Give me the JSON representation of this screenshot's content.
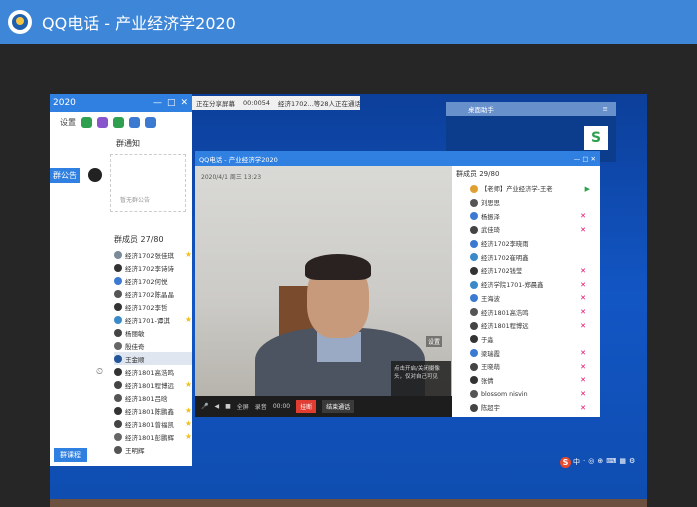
{
  "window": {
    "title": "QQ电话 - 产业经济学2020"
  },
  "left_panel": {
    "header_title": "2020",
    "settings_label": "设置",
    "notice_title": "群通知",
    "notice_tab": "群公告",
    "notice_empty": "暂无群公告",
    "member_header": "群成员 27/80",
    "members": [
      {
        "name": "经济1702张佳琪",
        "color": "#7a8a99",
        "star": true
      },
      {
        "name": "经济1702李诗诗",
        "color": "#333333",
        "star": false
      },
      {
        "name": "经济1702何悦",
        "color": "#3b7ad0",
        "star": false
      },
      {
        "name": "经济1702陈晶晶",
        "color": "#555555",
        "star": false
      },
      {
        "name": "经济1702李哲",
        "color": "#333333",
        "star": false
      },
      {
        "name": "经济1701-谭淇",
        "color": "#3a8ac9",
        "star": true
      },
      {
        "name": "杨丽敏",
        "color": "#444444",
        "star": false
      },
      {
        "name": "殷佳奇",
        "color": "#666666",
        "star": false
      },
      {
        "name": "王金顺",
        "color": "#225599",
        "star": false,
        "selected": true
      },
      {
        "name": "经济1801高浩鸣",
        "color": "#333333",
        "star": false
      },
      {
        "name": "经济1801程博远",
        "color": "#444444",
        "star": true
      },
      {
        "name": "经济1801吕晗",
        "color": "#555555",
        "star": false
      },
      {
        "name": "经济1801陈鹏鑫",
        "color": "#333333",
        "star": true
      },
      {
        "name": "经济1801曾福凯",
        "color": "#444444",
        "star": true
      },
      {
        "name": "经济1801彭鹏辉",
        "color": "#666666",
        "star": true
      },
      {
        "name": "王明辉",
        "color": "#555555",
        "star": false
      }
    ],
    "footer_button": "群课程"
  },
  "top_strip": {
    "call_label": "正在分享屏幕",
    "time": "00:0054",
    "info": "经济1702...等28人正在通话"
  },
  "right_window": {
    "title": "桌面助手"
  },
  "qq_call": {
    "title": "QQ电话 - 产业经济学2020",
    "video_time": "2020/4/1 周三 13:23",
    "setting_label": "设置",
    "popup_text": "点击开启/关闭摄像头，仅对自己可见",
    "controls": [
      "◀",
      "■",
      "全屏",
      "录音",
      "00:00"
    ],
    "end_label": "挂断",
    "end_label2": "结束通话",
    "member_title": "群成员 29/80",
    "members": [
      {
        "name": "【老师】产业经济学-王老",
        "color": "#e0a030",
        "status": "green"
      },
      {
        "name": "刘思思",
        "color": "#555555",
        "status": ""
      },
      {
        "name": "杨振泽",
        "color": "#3b7ad0",
        "status": "mic"
      },
      {
        "name": "武佳琦",
        "color": "#444444",
        "status": "mic"
      },
      {
        "name": "经济1702李晓雨",
        "color": "#3b7ad0",
        "status": ""
      },
      {
        "name": "经济1702崔明鑫",
        "color": "#3a8ac9",
        "status": ""
      },
      {
        "name": "经济1702钱莹",
        "color": "#333333",
        "status": "mic"
      },
      {
        "name": "经济学院1701-郑晨鑫",
        "color": "#3a8ac9",
        "status": "mic"
      },
      {
        "name": "王海波",
        "color": "#3b7ad0",
        "status": "mic"
      },
      {
        "name": "经济1801高浩鸣",
        "color": "#555555",
        "status": "mic"
      },
      {
        "name": "经济1801程博远",
        "color": "#444444",
        "status": "mic"
      },
      {
        "name": "于淼",
        "color": "#333333",
        "status": ""
      },
      {
        "name": "梁瑞霞",
        "color": "#3b7ad0",
        "status": "mic"
      },
      {
        "name": "王晓萌",
        "color": "#444444",
        "status": "mic"
      },
      {
        "name": "张倩",
        "color": "#333333",
        "status": "mic"
      },
      {
        "name": "blossom nisvin",
        "color": "#555555",
        "status": "mic"
      },
      {
        "name": "陈超宇",
        "color": "#444444",
        "status": "mic"
      }
    ]
  },
  "tray": {
    "items": [
      "中",
      "·",
      "◎",
      "⊕",
      "⌨",
      "▦",
      "⚙"
    ]
  }
}
